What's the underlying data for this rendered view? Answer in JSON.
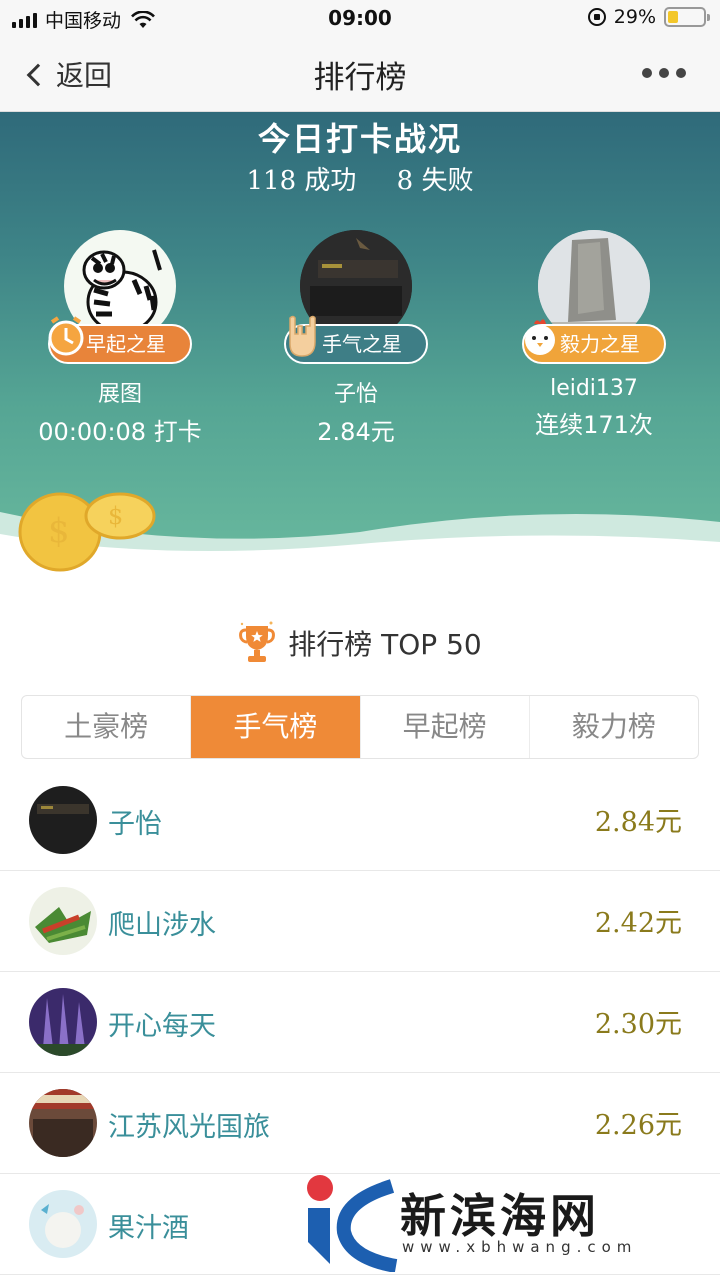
{
  "status_bar": {
    "carrier": "中国移动",
    "time": "09:00",
    "battery_percent": "29%",
    "battery_level": 0.29,
    "icons": [
      "signal-icon",
      "wifi-icon",
      "rotation-lock-icon",
      "battery-icon"
    ]
  },
  "nav": {
    "back_label": "返回",
    "title": "排行榜",
    "more_icon": "more-dots-icon"
  },
  "hero": {
    "title": "今日打卡战况",
    "success_text": "118 成功",
    "fail_text": "8 失败",
    "stars": [
      {
        "badge": "早起之星",
        "badge_icon": "clock-icon",
        "name": "展图",
        "sub": "00:00:08 打卡"
      },
      {
        "badge": "手气之星",
        "badge_icon": "rock-hand-icon",
        "name": "子怡",
        "sub": "2.84元"
      },
      {
        "badge": "毅力之星",
        "badge_icon": "chicken-icon",
        "name": "leidi137",
        "sub": "连续171次"
      }
    ],
    "colors": {
      "top": "#2f6a7a",
      "bottom": "#6bbb9f"
    }
  },
  "ranking": {
    "title": "排行榜 TOP 50",
    "tabs": [
      "土豪榜",
      "手气榜",
      "早起榜",
      "毅力榜"
    ],
    "active_tab": "手气榜",
    "rows": [
      {
        "name": "子怡",
        "value": "2.84元"
      },
      {
        "name": "爬山涉水",
        "value": "2.42元"
      },
      {
        "name": "开心每天",
        "value": "2.30元"
      },
      {
        "name": "江苏风光国旅",
        "value": "2.26元"
      },
      {
        "name": "果汁酒",
        "value": ""
      }
    ],
    "colors": {
      "accent": "#ef8a37",
      "name": "#3a8f9a",
      "value": "#8a7a1c"
    }
  },
  "watermark": {
    "text": "新滨海网",
    "url": "www.xbhwang.com"
  }
}
